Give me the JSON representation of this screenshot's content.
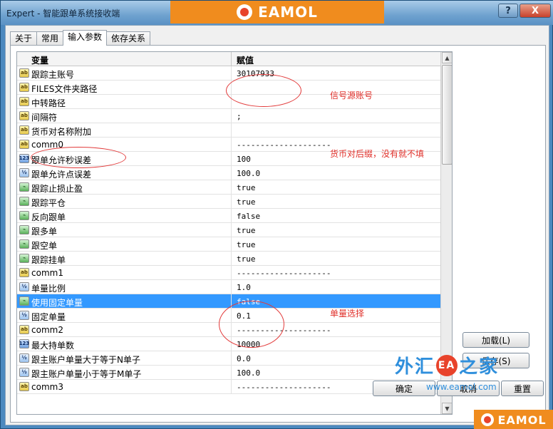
{
  "window": {
    "title": "Expert - 智能跟单系统接收端",
    "help_label": "?",
    "close_label": "X"
  },
  "brand": {
    "text": "EAMOL"
  },
  "tabs": [
    {
      "label": "关于",
      "active": false
    },
    {
      "label": "常用",
      "active": false
    },
    {
      "label": "输入参数",
      "active": true
    },
    {
      "label": "依存关系",
      "active": false
    }
  ],
  "grid": {
    "col_variable": "变量",
    "col_value": "赋值",
    "rows": [
      {
        "icon": "ab",
        "name": "跟踪主账号",
        "value": "30107933"
      },
      {
        "icon": "ab",
        "name": "FILES文件夹路径",
        "value": ""
      },
      {
        "icon": "ab",
        "name": "中转路径",
        "value": ""
      },
      {
        "icon": "ab",
        "name": "间隔符",
        "value": ";"
      },
      {
        "icon": "ab",
        "name": "货币对名称附加",
        "value": ""
      },
      {
        "icon": "ab",
        "name": "comm0",
        "value": "--------------------"
      },
      {
        "icon": "123",
        "name": "跟单允许秒误差",
        "value": "100"
      },
      {
        "icon": "1/2",
        "name": "跟单允许点误差",
        "value": "100.0"
      },
      {
        "icon": "bool",
        "name": "跟踪止损止盈",
        "value": "true"
      },
      {
        "icon": "bool",
        "name": "跟踪平仓",
        "value": "true"
      },
      {
        "icon": "bool",
        "name": "反向跟单",
        "value": "false"
      },
      {
        "icon": "bool",
        "name": "跟多单",
        "value": "true"
      },
      {
        "icon": "bool",
        "name": "跟空单",
        "value": "true"
      },
      {
        "icon": "bool",
        "name": "跟踪挂单",
        "value": "true"
      },
      {
        "icon": "ab",
        "name": "comm1",
        "value": "--------------------"
      },
      {
        "icon": "1/2",
        "name": "单量比例",
        "value": "1.0"
      },
      {
        "icon": "bool",
        "name": "使用固定单量",
        "value": "false",
        "selected": true
      },
      {
        "icon": "1/2",
        "name": "固定单量",
        "value": "0.1"
      },
      {
        "icon": "ab",
        "name": "comm2",
        "value": "--------------------"
      },
      {
        "icon": "123",
        "name": "最大持单数",
        "value": "10000"
      },
      {
        "icon": "1/2",
        "name": "跟主账户单量大于等于N单子",
        "value": "0.0"
      },
      {
        "icon": "1/2",
        "name": "跟主账户单量小于等于M单子",
        "value": "100.0"
      },
      {
        "icon": "ab",
        "name": "comm3",
        "value": "--------------------"
      }
    ]
  },
  "annotations": {
    "signal_account": "信号源账号",
    "symbol_suffix": "货币对后缀，没有就不填",
    "lot_select": "单量选择"
  },
  "buttons": {
    "load": "加载(L)",
    "save": "保存(S)",
    "ok": "确定",
    "cancel": "取消",
    "reset": "重置"
  },
  "watermark": {
    "text_left": "外汇",
    "seal": "EA",
    "text_right": "之家",
    "url": "www.eamol.com"
  }
}
